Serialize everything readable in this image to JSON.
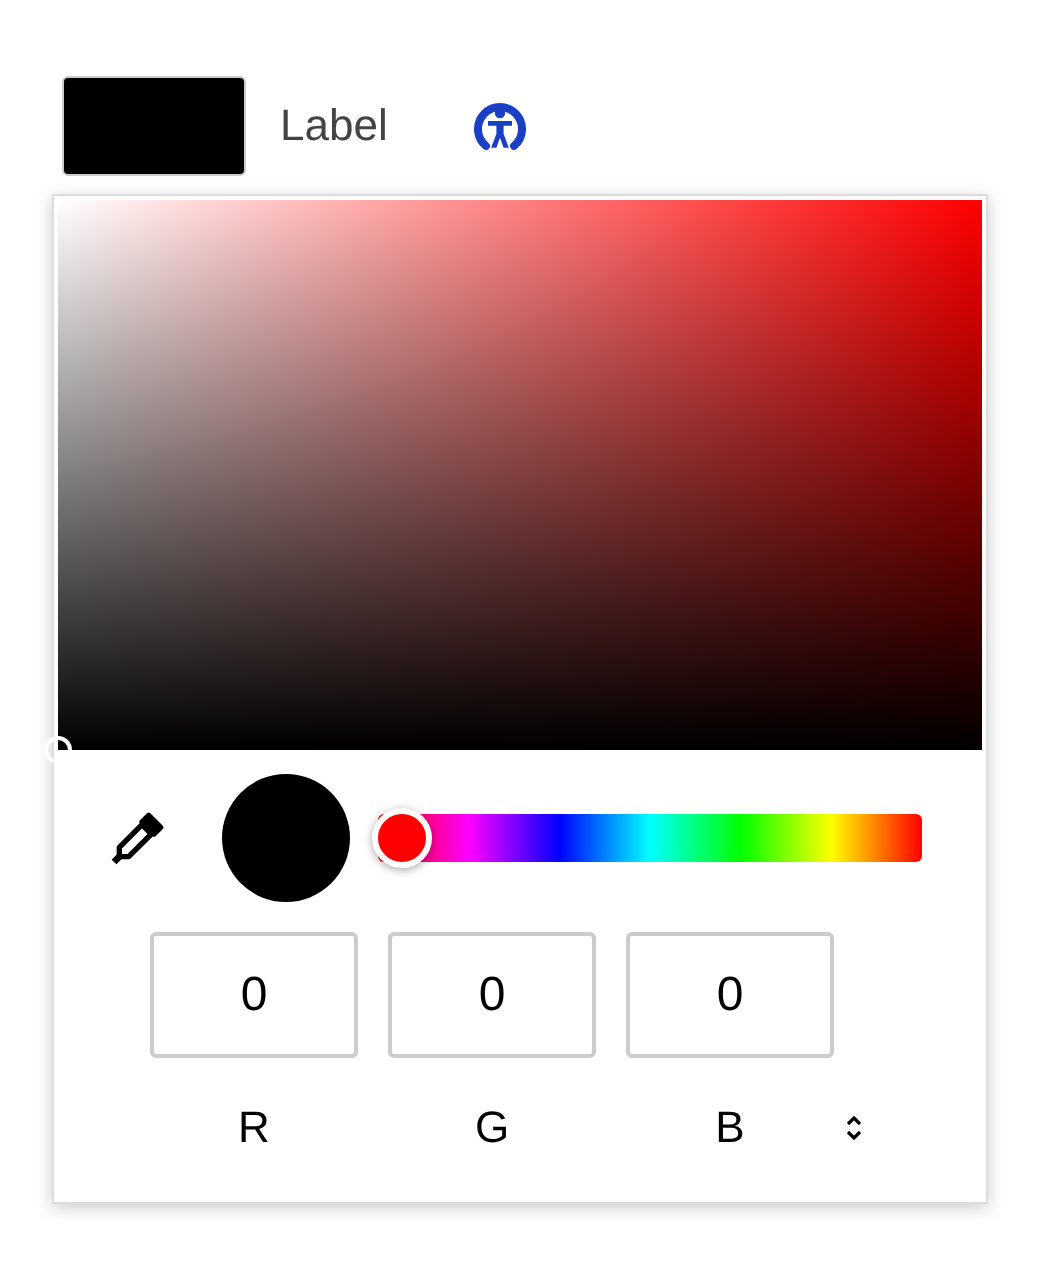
{
  "field": {
    "label": "Label"
  },
  "picker": {
    "hue": {
      "level": 0
    },
    "channels": [
      {
        "name": "R",
        "value": "0"
      },
      {
        "name": "G",
        "value": "0"
      },
      {
        "name": "B",
        "value": "0"
      }
    ]
  }
}
